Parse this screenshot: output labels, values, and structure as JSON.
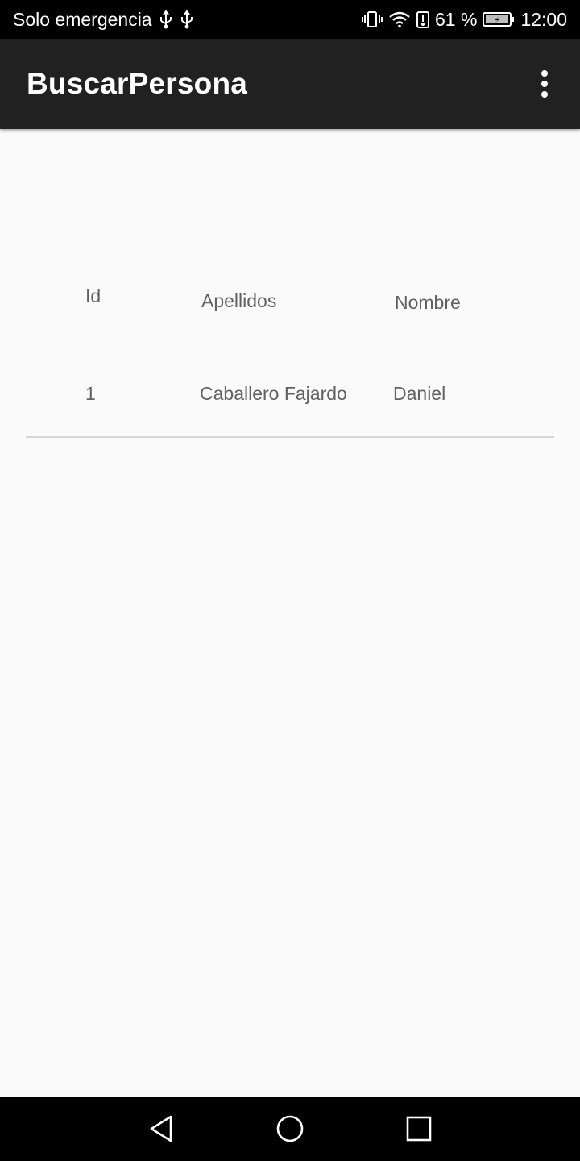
{
  "status_bar": {
    "carrier_text": "Solo emergencia",
    "battery_percent": "61 %",
    "time": "12:00",
    "icons": [
      "usb-icon",
      "usb-icon",
      "vibrate-icon",
      "wifi-icon",
      "battery-alert-icon",
      "battery-charging-icon"
    ]
  },
  "app_bar": {
    "title": "BuscarPersona",
    "menu_icon": "more-vert-icon"
  },
  "table": {
    "headers": {
      "id": "Id",
      "apellidos": "Apellidos",
      "nombre": "Nombre"
    },
    "rows": [
      {
        "id": "1",
        "apellidos": "Caballero Fajardo",
        "nombre": "Daniel"
      }
    ]
  },
  "nav_bar": {
    "icons": [
      "back-icon",
      "home-icon",
      "recents-icon"
    ]
  },
  "colors": {
    "status_bar": "#000000",
    "app_bar": "#212121",
    "background": "#fafafa",
    "text": "#616161",
    "divider": "#d6d6d6"
  }
}
